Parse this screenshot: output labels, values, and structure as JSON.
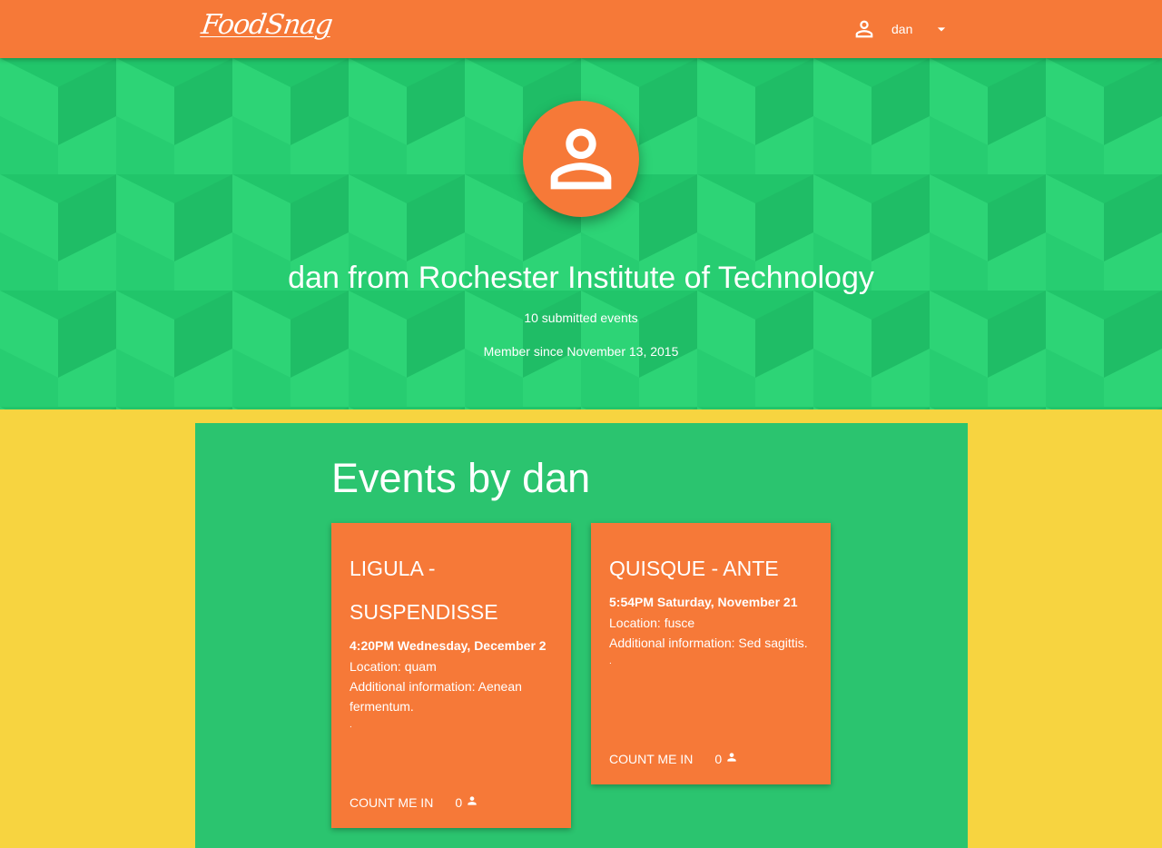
{
  "header": {
    "logo_text": "FoodSnag",
    "username": "dan",
    "user_icon": "person-icon",
    "menu_icon": "arrow-drop-down-icon"
  },
  "profile": {
    "title": "dan from Rochester Institute of Technology",
    "submitted": "10 submitted events",
    "member_since": "Member since November 13, 2015"
  },
  "events": {
    "heading": "Events by dan",
    "cards": [
      {
        "title": "LIGULA - SUSPENDISSE",
        "time": "4:20PM Wednesday, December 2",
        "location": "Location: quam",
        "info": "Additional information: Aenean fermentum.",
        "dot": ".",
        "button": "COUNT ME IN",
        "count": "0"
      },
      {
        "title": "QUISQUE - ANTE",
        "time": "5:54PM Saturday, November 21",
        "location": "Location: fusce",
        "info": "Additional information: Sed sagittis.",
        "dot": ".",
        "button": "COUNT ME IN",
        "count": "0"
      }
    ]
  },
  "colors": {
    "primary": "#f67938",
    "hero_green": "#21c56a",
    "panel_green": "#2bc46f",
    "page_yellow": "#f7d440"
  }
}
